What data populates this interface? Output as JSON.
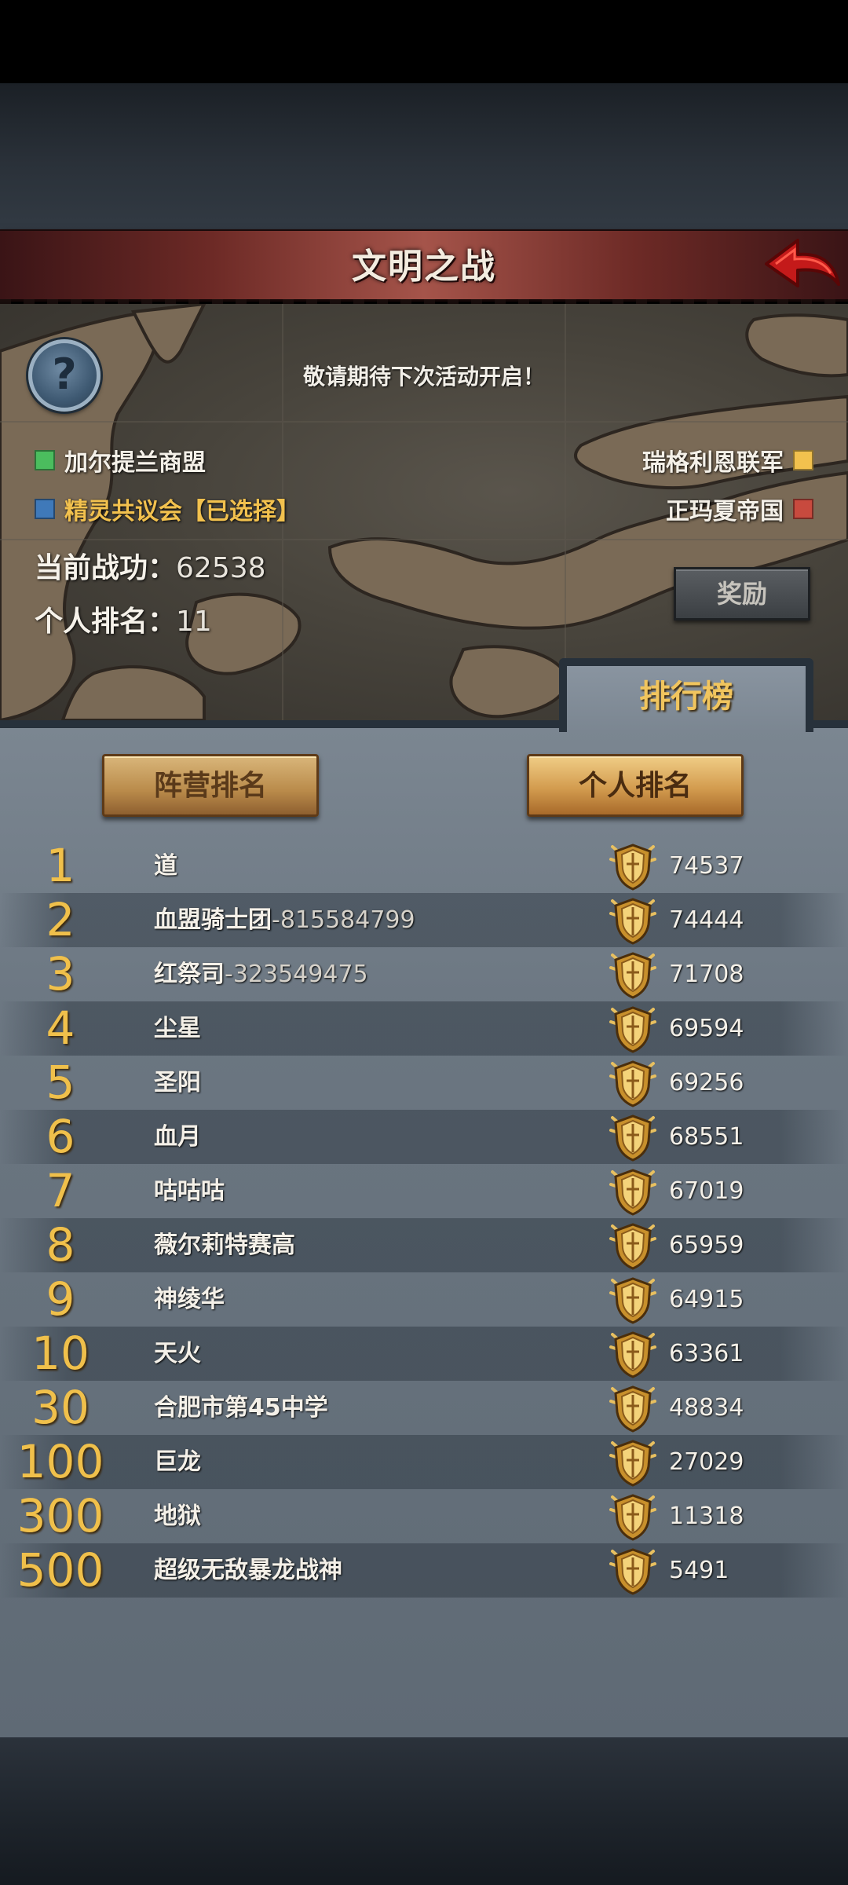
{
  "header": {
    "title": "文明之战"
  },
  "notice": "敬请期待下次活动开启！",
  "help": {
    "glyph": "?"
  },
  "factions": {
    "left": [
      {
        "name": "加尔提兰商盟",
        "color": "#4bbd5e"
      },
      {
        "name": "精灵共议会【已选择】",
        "color": "#3f79b9",
        "selected": true
      }
    ],
    "right": [
      {
        "name": "瑞格利恩联军",
        "color": "#f2c14e"
      },
      {
        "name": "正玛夏帝国",
        "color": "#c84a3e"
      }
    ]
  },
  "stats": {
    "merit_label": "当前战功：",
    "merit_value": "62538",
    "rank_label": "个人排名：",
    "rank_value": "11"
  },
  "reward_button": "奖励",
  "panel_tab": "排行榜",
  "filters": {
    "faction": "阵营排名",
    "personal": "个人排名"
  },
  "leaderboard": [
    {
      "rank": "1",
      "name": "道",
      "suffix": "",
      "score": "74537"
    },
    {
      "rank": "2",
      "name": "血盟骑士团",
      "suffix": "-815584799",
      "score": "74444"
    },
    {
      "rank": "3",
      "name": "红祭司",
      "suffix": "-323549475",
      "score": "71708"
    },
    {
      "rank": "4",
      "name": "尘星",
      "suffix": "",
      "score": "69594"
    },
    {
      "rank": "5",
      "name": "圣阳",
      "suffix": "",
      "score": "69256"
    },
    {
      "rank": "6",
      "name": "血月",
      "suffix": "",
      "score": "68551"
    },
    {
      "rank": "7",
      "name": "咕咕咕",
      "suffix": "",
      "score": "67019"
    },
    {
      "rank": "8",
      "name": "薇尔莉特赛高",
      "suffix": "",
      "score": "65959"
    },
    {
      "rank": "9",
      "name": "神绫华",
      "suffix": "",
      "score": "64915"
    },
    {
      "rank": "10",
      "name": "天火",
      "suffix": "",
      "score": "63361"
    },
    {
      "rank": "30",
      "name": "合肥市第45中学",
      "suffix": "",
      "score": "48834"
    },
    {
      "rank": "100",
      "name": "巨龙",
      "suffix": "",
      "score": "27029"
    },
    {
      "rank": "300",
      "name": "地狱",
      "suffix": "",
      "score": "11318"
    },
    {
      "rank": "500",
      "name": "超级无敌暴龙战神",
      "suffix": "",
      "score": "5491"
    }
  ],
  "colors": {
    "title_bar": "#8a3a34",
    "gold": "#f0c04b",
    "panel": "#6b7681"
  },
  "icons": {
    "back": "back-arrow-icon",
    "help": "question-icon",
    "medal": "shield-medal-icon"
  }
}
